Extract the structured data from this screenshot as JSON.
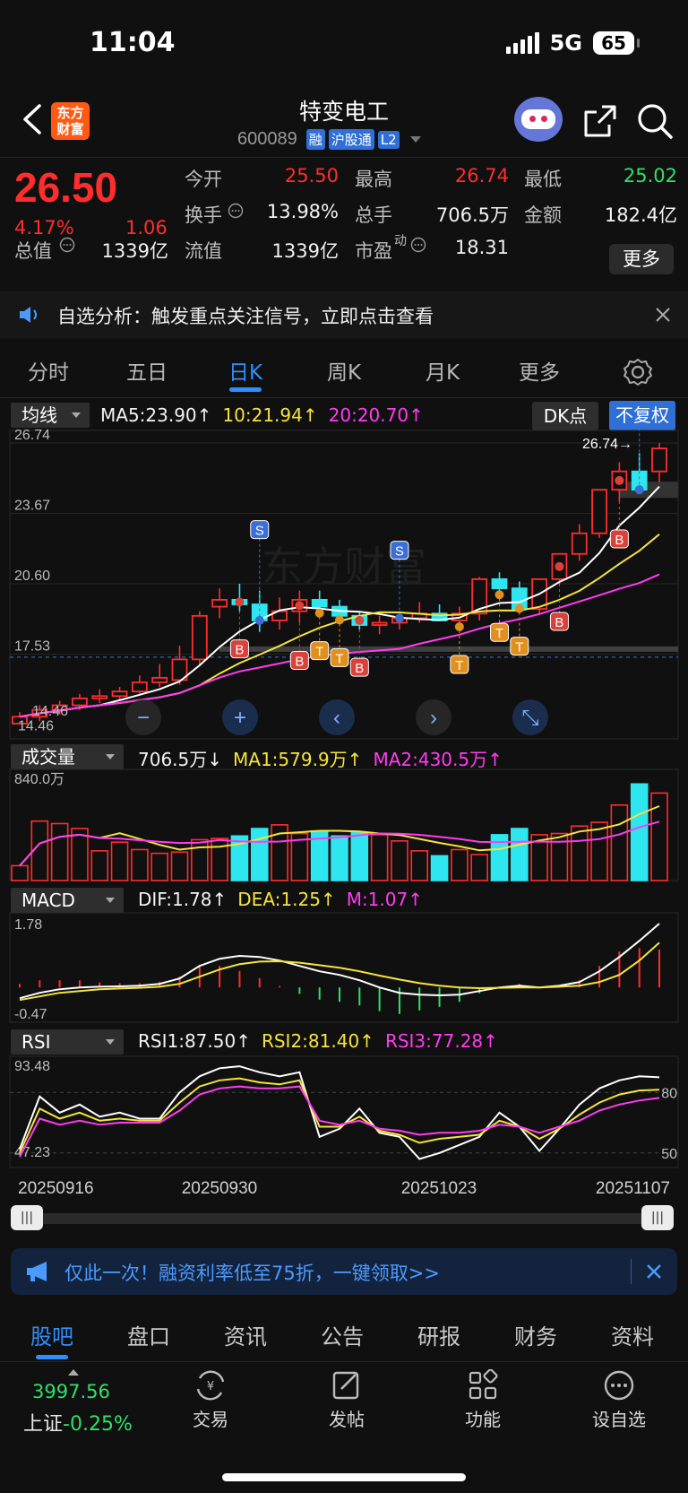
{
  "status_bar": {
    "time": "11:04",
    "network": "5G",
    "battery": "65"
  },
  "header": {
    "logo_line1": "东方",
    "logo_line2": "财富",
    "stock_name": "特变电工",
    "stock_code": "600089",
    "tags": [
      "融",
      "沪股通",
      "L2"
    ]
  },
  "quote": {
    "price": "26.50",
    "change_pct": "4.17%",
    "change": "1.06",
    "fields": [
      {
        "label": "今开",
        "value": "25.50",
        "color": "#ff2d2d"
      },
      {
        "label": "最高",
        "value": "26.74",
        "color": "#ff2d2d"
      },
      {
        "label": "最低",
        "value": "25.02",
        "color": "#2ee06a"
      },
      {
        "label": "换手",
        "value": "13.98%",
        "color": "#f2f2f2"
      },
      {
        "label": "总手",
        "value": "706.5万",
        "color": "#f2f2f2"
      },
      {
        "label": "金额",
        "value": "182.4亿",
        "color": "#f2f2f2"
      },
      {
        "label": "总值",
        "value": "1339亿",
        "color": "#f2f2f2"
      },
      {
        "label": "流值",
        "value": "1339亿",
        "color": "#f2f2f2"
      },
      {
        "label": "市盈",
        "value": "18.31",
        "color": "#f2f2f2"
      }
    ],
    "pe_superscript": "动",
    "more_label": "更多"
  },
  "notice": {
    "text": "自选分析：触发重点关注信号，立即点击查看"
  },
  "period_tabs": [
    "分时",
    "五日",
    "日K",
    "周K",
    "月K",
    "更多"
  ],
  "active_period": "日K",
  "kline": {
    "indicator": "均线",
    "ma5": "MA5:23.90↑",
    "ma10": "10:21.94↑",
    "ma20": "20:20.70↑",
    "dk_label": "DK点",
    "adjust_label": "不复权",
    "price_ticks": [
      "26.74",
      "23.67",
      "20.60",
      "17.53"
    ],
    "high_label": "26.74",
    "low_label": "14.46",
    "low_label2": "14.46"
  },
  "volume": {
    "indicator": "成交量",
    "vol": "706.5万↓",
    "ma1": "MA1:579.9万↑",
    "ma2": "MA2:430.5万↑",
    "max_tick": "840.0万"
  },
  "macd": {
    "indicator": "MACD",
    "dif": "DIF:1.78↑",
    "dea": "DEA:1.25↑",
    "m": "M:1.07↑",
    "top_tick": "1.78",
    "bottom_tick": "-0.47"
  },
  "rsi": {
    "indicator": "RSI",
    "rsi1": "RSI1:87.50↑",
    "rsi2": "RSI2:81.40↑",
    "rsi3": "RSI3:77.28↑",
    "top_tick": "93.48",
    "bottom_tick": "47.23",
    "ref_high": "80",
    "ref_low": "50"
  },
  "dates": [
    "20250916",
    "20250930",
    "20251023",
    "20251107"
  ],
  "promo": {
    "text": "仅此一次！融资利率低至75折，一键领取>>"
  },
  "info_tabs": [
    "股吧",
    "盘口",
    "资讯",
    "公告",
    "研报",
    "财务",
    "资料"
  ],
  "active_info_tab": "股吧",
  "toolbar": {
    "index_value": "3997.56",
    "index_name": "上证",
    "index_pct": "-0.25%",
    "items": [
      "交易",
      "发帖",
      "功能",
      "设自选"
    ]
  },
  "chart_data": [
    {
      "type": "candlestick",
      "title": "",
      "x": [
        "20250916",
        "",
        "",
        "",
        "",
        "",
        "",
        "",
        "20250930",
        "",
        "",
        "",
        "",
        "",
        "",
        "",
        "",
        "",
        "",
        "20251023",
        "",
        "",
        "",
        "",
        "",
        "",
        "",
        "",
        "",
        "",
        "",
        "",
        "20251107"
      ],
      "open": [
        14.5,
        14.8,
        15.1,
        15.3,
        15.6,
        15.7,
        15.9,
        16.3,
        16.4,
        17.3,
        19.6,
        19.9,
        19.7,
        19.0,
        19.4,
        19.9,
        19.6,
        19.2,
        18.8,
        18.9,
        19.1,
        19.3,
        19.0,
        19.3,
        20.8,
        20.4,
        19.5,
        20.8,
        21.9,
        22.8,
        24.7,
        25.5,
        25.5
      ],
      "high": [
        15.0,
        15.3,
        15.5,
        15.8,
        16.0,
        16.1,
        16.6,
        17.1,
        17.9,
        19.4,
        20.4,
        20.6,
        20.3,
        20.0,
        20.3,
        20.3,
        19.9,
        19.4,
        19.2,
        19.4,
        19.8,
        19.7,
        19.6,
        20.9,
        21.1,
        20.7,
        20.4,
        21.9,
        23.2,
        24.6,
        25.9,
        26.3,
        26.74
      ],
      "low": [
        14.46,
        14.6,
        14.9,
        15.1,
        15.4,
        15.5,
        15.8,
        16.1,
        16.2,
        17.0,
        19.1,
        19.4,
        18.5,
        18.6,
        18.9,
        19.4,
        19.1,
        18.6,
        18.4,
        18.6,
        18.9,
        19.0,
        18.8,
        19.0,
        20.2,
        19.6,
        19.3,
        20.6,
        21.6,
        22.6,
        24.2,
        25.1,
        25.02
      ],
      "close": [
        14.8,
        15.1,
        15.3,
        15.6,
        15.7,
        15.9,
        16.3,
        16.5,
        17.3,
        19.2,
        19.9,
        19.7,
        19.0,
        19.4,
        19.9,
        19.6,
        19.2,
        18.8,
        18.9,
        19.1,
        19.3,
        19.0,
        19.3,
        20.8,
        20.4,
        19.5,
        20.8,
        21.9,
        22.8,
        24.7,
        25.5,
        24.7,
        26.5
      ],
      "series": [
        {
          "name": "MA5",
          "color": "#ffffff"
        },
        {
          "name": "MA10",
          "color": "#f5e43a"
        },
        {
          "name": "MA20",
          "color": "#ff3cf0"
        }
      ],
      "ylim": [
        14.46,
        26.74
      ],
      "markers": [
        "S",
        "B",
        "T"
      ]
    },
    {
      "type": "bar",
      "title": "成交量",
      "values_wan": [
        120,
        480,
        460,
        420,
        240,
        310,
        250,
        220,
        230,
        330,
        340,
        360,
        420,
        450,
        380,
        400,
        360,
        390,
        370,
        320,
        240,
        200,
        250,
        210,
        370,
        420,
        370,
        380,
        440,
        470,
        610,
        780,
        706.5
      ],
      "ylim": [
        0,
        840
      ]
    },
    {
      "type": "line",
      "title": "MACD",
      "series": [
        {
          "name": "DIF",
          "color": "#ffffff",
          "values": [
            -0.3,
            -0.15,
            -0.05,
            0.0,
            0.02,
            0.03,
            0.05,
            0.1,
            0.25,
            0.6,
            0.8,
            0.88,
            0.85,
            0.75,
            0.6,
            0.45,
            0.35,
            0.2,
            0.0,
            -0.15,
            -0.2,
            -0.22,
            -0.2,
            -0.1,
            0.0,
            0.05,
            0.0,
            0.05,
            0.15,
            0.45,
            0.85,
            1.3,
            1.78
          ]
        },
        {
          "name": "DEA",
          "color": "#f5e43a",
          "values": [
            -0.35,
            -0.25,
            -0.15,
            -0.1,
            -0.05,
            -0.03,
            -0.01,
            0.02,
            0.1,
            0.3,
            0.5,
            0.65,
            0.72,
            0.73,
            0.69,
            0.62,
            0.55,
            0.45,
            0.33,
            0.22,
            0.12,
            0.05,
            0.0,
            -0.02,
            -0.01,
            0.0,
            0.0,
            0.02,
            0.05,
            0.15,
            0.35,
            0.75,
            1.25
          ]
        }
      ],
      "ylim": [
        -0.47,
        1.78
      ]
    },
    {
      "type": "line",
      "title": "RSI",
      "series": [
        {
          "name": "RSI1",
          "color": "#ffffff",
          "values": [
            52,
            78,
            70,
            74,
            68,
            70,
            67,
            67,
            80,
            88,
            92,
            93,
            90,
            88,
            90,
            58,
            62,
            72,
            60,
            58,
            47,
            50,
            54,
            58,
            70,
            63,
            51,
            62,
            74,
            82,
            86,
            88,
            87.5
          ]
        },
        {
          "name": "RSI2",
          "color": "#f5e43a",
          "values": [
            50,
            72,
            67,
            70,
            66,
            67,
            66,
            66,
            75,
            83,
            86,
            87,
            85,
            84,
            86,
            63,
            63,
            68,
            61,
            59,
            55,
            57,
            58,
            59,
            66,
            63,
            57,
            62,
            69,
            75,
            79,
            81,
            81.4
          ]
        },
        {
          "name": "RSI3",
          "color": "#ff3cf0",
          "values": [
            48,
            67,
            64,
            66,
            64,
            65,
            65,
            65,
            71,
            79,
            82,
            83,
            82,
            82,
            83,
            66,
            64,
            66,
            62,
            61,
            59,
            60,
            60,
            61,
            64,
            63,
            60,
            63,
            66,
            71,
            74,
            76,
            77.28
          ]
        }
      ],
      "ylim": [
        47.23,
        93.48
      ]
    }
  ]
}
